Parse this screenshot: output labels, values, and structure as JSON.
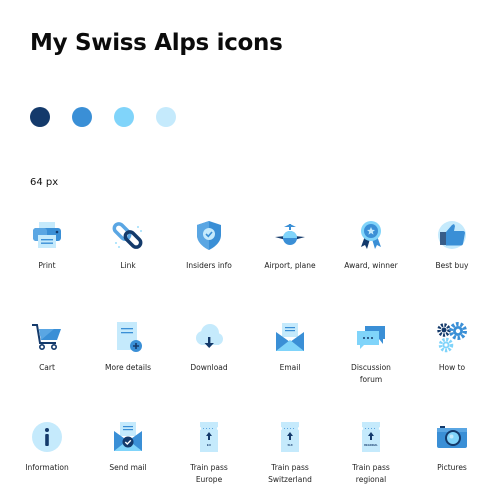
{
  "header": {
    "title": "My Swiss Alps icons"
  },
  "palette": [
    {
      "name": "navy",
      "color": "#143a6b"
    },
    {
      "name": "blue",
      "color": "#3a8fd6"
    },
    {
      "name": "light-blue",
      "color": "#80d4fa"
    },
    {
      "name": "pale-blue",
      "color": "#c5eafc"
    }
  ],
  "size_label": "64 px",
  "icons": [
    {
      "label": "Print",
      "icon": "printer-icon"
    },
    {
      "label": "Link",
      "icon": "link-icon"
    },
    {
      "label": "Insiders info",
      "icon": "shield-check-icon"
    },
    {
      "label": "Airport, plane",
      "icon": "plane-icon"
    },
    {
      "label": "Award, winner",
      "icon": "award-icon"
    },
    {
      "label": "Best buy",
      "icon": "thumbs-up-icon"
    },
    {
      "label": "Cart",
      "icon": "cart-icon"
    },
    {
      "label": "More details",
      "icon": "document-plus-icon"
    },
    {
      "label": "Download",
      "icon": "cloud-download-icon"
    },
    {
      "label": "Email",
      "icon": "envelope-open-icon"
    },
    {
      "label": "Discussion\nforum",
      "icon": "chat-bubbles-icon"
    },
    {
      "label": "How to",
      "icon": "gears-icon"
    },
    {
      "label": "Information",
      "icon": "info-icon"
    },
    {
      "label": "Send mail",
      "icon": "envelope-check-icon"
    },
    {
      "label": "Train pass\nEurope",
      "icon": "train-pass-eu-icon",
      "pass_text": "EU"
    },
    {
      "label": "Train pass\nSwitzerland",
      "icon": "train-pass-ch-icon",
      "pass_text": "SUI"
    },
    {
      "label": "Train pass\nregional",
      "icon": "train-pass-regional-icon",
      "pass_text": "REGIONAL"
    },
    {
      "label": "Pictures",
      "icon": "camera-icon"
    }
  ]
}
